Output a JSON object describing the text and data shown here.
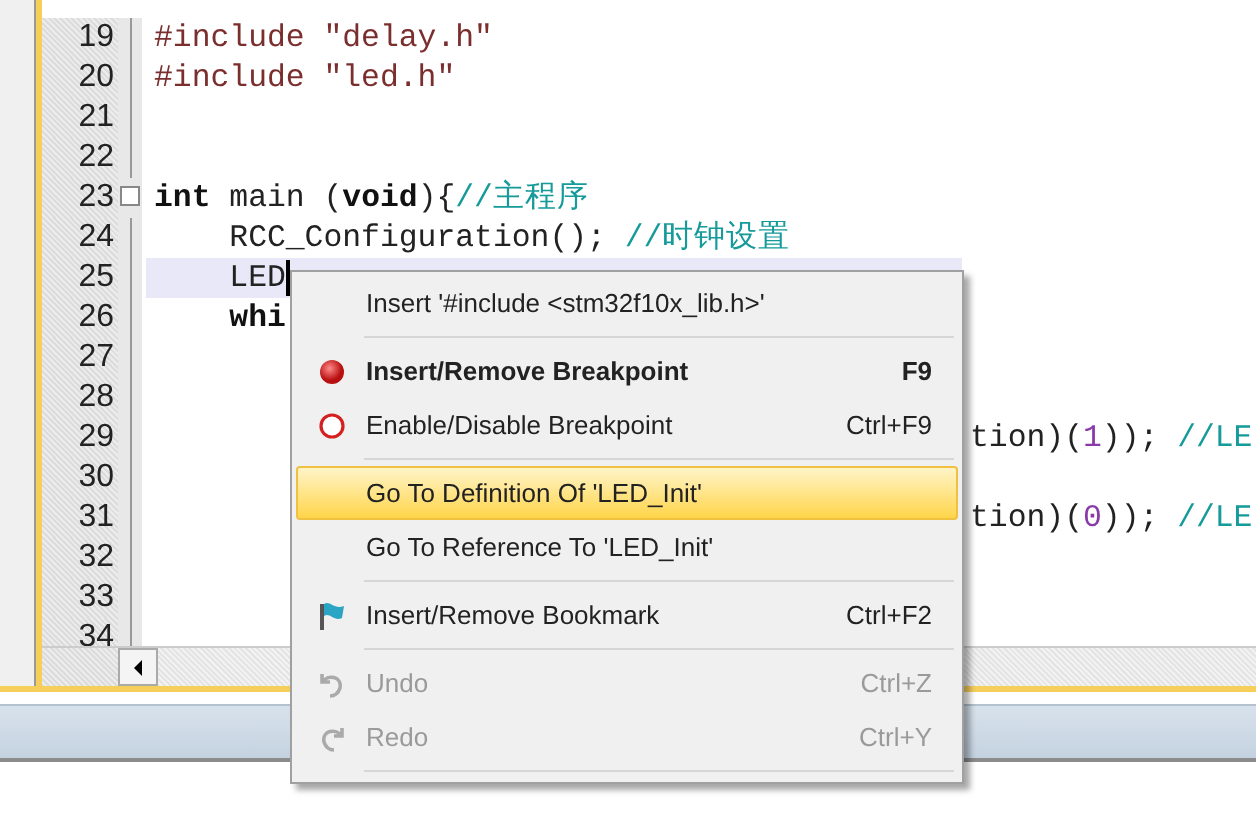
{
  "editor": {
    "lines": [
      {
        "number": "19",
        "kind": "code",
        "current": false,
        "tokens": [
          {
            "text": "#include ",
            "kind": "directive"
          },
          {
            "text": "\"delay.h\"",
            "kind": "string"
          }
        ]
      },
      {
        "number": "20",
        "kind": "code",
        "current": false,
        "tokens": [
          {
            "text": "#include ",
            "kind": "directive"
          },
          {
            "text": "\"led.h\"",
            "kind": "string"
          }
        ]
      },
      {
        "number": "21",
        "kind": "code",
        "current": false
      },
      {
        "number": "22",
        "kind": "code",
        "current": false
      },
      {
        "number": "23",
        "kind": "fold",
        "current": false,
        "tokens": [
          {
            "text": "int",
            "kind": "keyword"
          },
          {
            "text": " main (",
            "kind": "plain"
          },
          {
            "text": "void",
            "kind": "keyword"
          },
          {
            "text": "){",
            "kind": "plain"
          },
          {
            "text": "//主程序",
            "kind": "comment"
          }
        ]
      },
      {
        "number": "24",
        "kind": "code",
        "current": false,
        "tokens": [
          {
            "text": "    RCC_Configuration(); ",
            "kind": "plain"
          },
          {
            "text": "//时钟设置",
            "kind": "comment"
          }
        ]
      },
      {
        "number": "25",
        "kind": "code",
        "current": true,
        "tokens": [
          {
            "text": "    LED",
            "kind": "plain"
          }
        ]
      },
      {
        "number": "26",
        "kind": "code",
        "current": false,
        "tokens": [
          {
            "text": "    whi",
            "kind": "keyword"
          }
        ]
      },
      {
        "number": "27",
        "kind": "code",
        "current": false
      },
      {
        "number": "28",
        "kind": "code",
        "current": false
      },
      {
        "number": "29",
        "kind": "code",
        "current": false,
        "tokens_right": [
          {
            "text": "tion)(",
            "kind": "plain"
          },
          {
            "text": "1",
            "kind": "number"
          },
          {
            "text": ")); ",
            "kind": "plain"
          },
          {
            "text": "//LE",
            "kind": "comment"
          }
        ]
      },
      {
        "number": "30",
        "kind": "code",
        "current": false
      },
      {
        "number": "31",
        "kind": "code",
        "current": false,
        "tokens_right": [
          {
            "text": "tion)(",
            "kind": "plain"
          },
          {
            "text": "0",
            "kind": "number"
          },
          {
            "text": ")); ",
            "kind": "plain"
          },
          {
            "text": "//LE",
            "kind": "comment"
          }
        ]
      },
      {
        "number": "32",
        "kind": "code",
        "current": false
      },
      {
        "number": "33",
        "kind": "code",
        "current": false
      },
      {
        "number": "34",
        "kind": "code",
        "current": false
      }
    ]
  },
  "context_menu": {
    "items": [
      {
        "kind": "command",
        "label": "Insert '#include <stm32f10x_lib.h>'",
        "bold": false,
        "disabled": false,
        "selected": false
      },
      {
        "kind": "separator"
      },
      {
        "kind": "breakpoint",
        "label": "Insert/Remove Breakpoint",
        "shortcut": "F9",
        "bold": true,
        "disabled": false,
        "selected": false
      },
      {
        "kind": "breakpoint-outline",
        "label": "Enable/Disable Breakpoint",
        "shortcut": "Ctrl+F9",
        "bold": false,
        "disabled": false,
        "selected": false
      },
      {
        "kind": "separator"
      },
      {
        "kind": "command",
        "label": "Go To Definition Of 'LED_Init'",
        "bold": false,
        "disabled": false,
        "selected": true
      },
      {
        "kind": "command",
        "label": "Go To Reference To 'LED_Init'",
        "bold": false,
        "disabled": false,
        "selected": false
      },
      {
        "kind": "separator"
      },
      {
        "kind": "bookmark",
        "label": "Insert/Remove Bookmark",
        "shortcut": "Ctrl+F2",
        "bold": false,
        "disabled": false,
        "selected": false
      },
      {
        "kind": "separator"
      },
      {
        "kind": "undo",
        "label": "Undo",
        "shortcut": "Ctrl+Z",
        "bold": false,
        "disabled": true,
        "selected": false
      },
      {
        "kind": "redo",
        "label": "Redo",
        "shortcut": "Ctrl+Y",
        "bold": false,
        "disabled": true,
        "selected": false
      },
      {
        "kind": "separator"
      }
    ]
  }
}
